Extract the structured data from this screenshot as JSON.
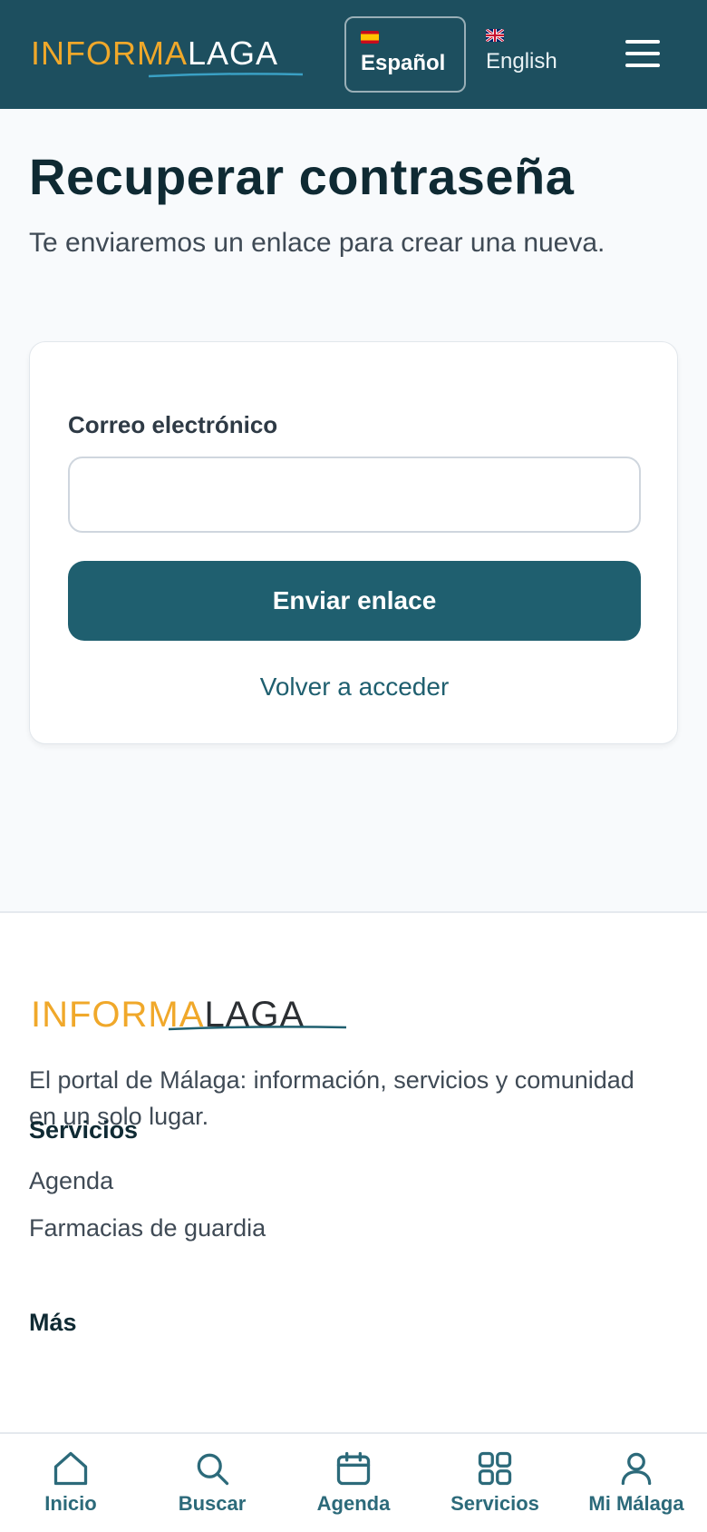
{
  "header": {
    "logo_part1": "INFORMA",
    "logo_part2": "LAGA",
    "languages": [
      {
        "label": "Español",
        "flag": "spain-flag-icon",
        "active": true
      },
      {
        "label": "English",
        "flag": "uk-flag-icon",
        "active": false
      }
    ],
    "menu_icon": "hamburger-menu-icon"
  },
  "main": {
    "title": "Recuperar contraseña",
    "subtitle": "Te enviaremos un enlace para crear una nueva.",
    "form": {
      "email_label": "Correo electrónico",
      "email_value": "",
      "email_placeholder": "",
      "submit_label": "Enviar enlace",
      "back_link": "Volver a acceder"
    }
  },
  "footer": {
    "logo_part1": "INFORMA",
    "logo_part2": "LAGA",
    "description": "El portal de Málaga: información, servicios y comunidad en un solo lugar.",
    "sections": [
      {
        "heading": "Servicios",
        "links": [
          "Agenda",
          "Farmacias de guardia"
        ]
      },
      {
        "heading": "Más",
        "links": []
      }
    ]
  },
  "bottom_nav": [
    {
      "label": "Inicio",
      "icon": "home-icon"
    },
    {
      "label": "Buscar",
      "icon": "search-icon"
    },
    {
      "label": "Agenda",
      "icon": "calendar-icon"
    },
    {
      "label": "Servicios",
      "icon": "grid-icon"
    },
    {
      "label": "Mi Málaga",
      "icon": "user-icon"
    }
  ],
  "colors": {
    "header_bg": "#1d4f5f",
    "accent": "#1f5f6f",
    "logo_orange": "#f0a82a"
  }
}
